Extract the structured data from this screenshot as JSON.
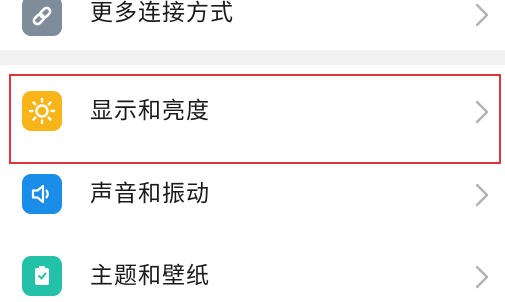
{
  "settings": {
    "items": [
      {
        "label": "更多连接方式",
        "icon": "link-icon",
        "color": "#7f8c9b"
      },
      {
        "label": "显示和亮度",
        "icon": "sun-icon",
        "color": "#f7b51a",
        "highlighted": true
      },
      {
        "label": "声音和振动",
        "icon": "speaker-icon",
        "color": "#1a8de8"
      },
      {
        "label": "主题和壁纸",
        "icon": "theme-icon",
        "color": "#23c2a8"
      }
    ]
  },
  "colors": {
    "highlight": "#e0333b",
    "chevron": "#b3b3b3",
    "divider_band": "#f2f2f2"
  }
}
